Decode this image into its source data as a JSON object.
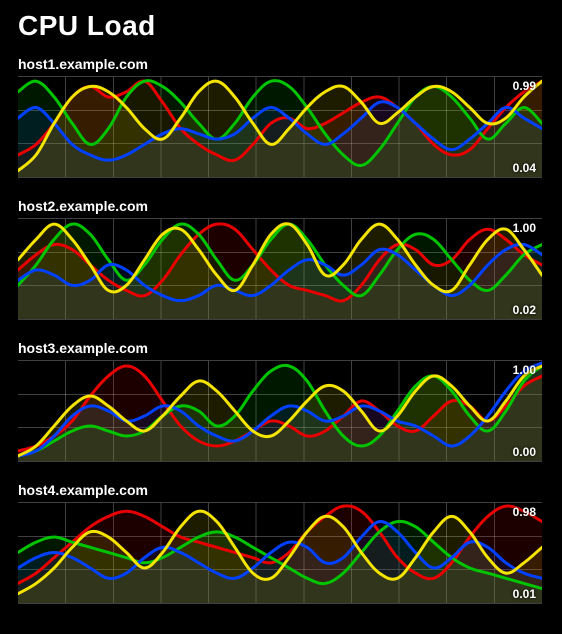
{
  "title": "CPU Load",
  "colors": {
    "red": "#e80000",
    "green": "#00c400",
    "blue": "#0040ff",
    "yellow": "#f5e400"
  },
  "grid": {
    "vlines": 11,
    "hlines": 3
  },
  "chart_data": [
    {
      "type": "line",
      "title": "host1.example.com",
      "ylim": [
        0.04,
        0.99
      ],
      "max_label": "0.99",
      "min_label": "0.04",
      "x": [
        0,
        1,
        2,
        3,
        4,
        5,
        6,
        7,
        8,
        9,
        10,
        11,
        12,
        13,
        14,
        15,
        16,
        17,
        18,
        19,
        20,
        21,
        22,
        23,
        24,
        25,
        26,
        27,
        28,
        29
      ],
      "series": [
        {
          "name": "red",
          "values": [
            0.25,
            0.35,
            0.55,
            0.8,
            0.9,
            0.8,
            0.85,
            0.95,
            0.75,
            0.5,
            0.35,
            0.25,
            0.2,
            0.35,
            0.55,
            0.6,
            0.5,
            0.55,
            0.65,
            0.75,
            0.8,
            0.7,
            0.55,
            0.35,
            0.25,
            0.3,
            0.5,
            0.7,
            0.85,
            0.95
          ]
        },
        {
          "name": "green",
          "values": [
            0.85,
            0.95,
            0.8,
            0.55,
            0.35,
            0.5,
            0.8,
            0.95,
            0.9,
            0.75,
            0.55,
            0.4,
            0.55,
            0.8,
            0.95,
            0.9,
            0.7,
            0.45,
            0.25,
            0.15,
            0.3,
            0.55,
            0.8,
            0.9,
            0.8,
            0.6,
            0.4,
            0.55,
            0.7,
            0.55
          ]
        },
        {
          "name": "blue",
          "values": [
            0.6,
            0.7,
            0.55,
            0.35,
            0.25,
            0.2,
            0.25,
            0.35,
            0.45,
            0.5,
            0.45,
            0.4,
            0.45,
            0.6,
            0.7,
            0.6,
            0.45,
            0.35,
            0.45,
            0.6,
            0.75,
            0.7,
            0.55,
            0.4,
            0.3,
            0.4,
            0.55,
            0.7,
            0.6,
            0.5
          ]
        },
        {
          "name": "yellow",
          "values": [
            0.1,
            0.25,
            0.55,
            0.8,
            0.9,
            0.85,
            0.7,
            0.5,
            0.4,
            0.6,
            0.85,
            0.95,
            0.8,
            0.55,
            0.35,
            0.5,
            0.7,
            0.85,
            0.9,
            0.75,
            0.55,
            0.65,
            0.8,
            0.9,
            0.85,
            0.7,
            0.55,
            0.6,
            0.8,
            0.95
          ]
        }
      ]
    },
    {
      "type": "line",
      "title": "host2.example.com",
      "ylim": [
        0.02,
        1.0
      ],
      "max_label": "1.00",
      "min_label": "0.02",
      "x": [
        0,
        1,
        2,
        3,
        4,
        5,
        6,
        7,
        8,
        9,
        10,
        11,
        12,
        13,
        14,
        15,
        16,
        17,
        18,
        19,
        20,
        21,
        22,
        23,
        24,
        25,
        26,
        27,
        28,
        29
      ],
      "series": [
        {
          "name": "red",
          "values": [
            0.5,
            0.65,
            0.75,
            0.7,
            0.55,
            0.4,
            0.3,
            0.25,
            0.4,
            0.65,
            0.85,
            0.95,
            0.9,
            0.7,
            0.5,
            0.35,
            0.3,
            0.25,
            0.2,
            0.35,
            0.6,
            0.75,
            0.7,
            0.55,
            0.6,
            0.8,
            0.9,
            0.8,
            0.65,
            0.55
          ]
        },
        {
          "name": "green",
          "values": [
            0.35,
            0.55,
            0.8,
            0.95,
            0.85,
            0.6,
            0.4,
            0.55,
            0.8,
            0.95,
            0.85,
            0.6,
            0.4,
            0.55,
            0.8,
            0.95,
            0.8,
            0.55,
            0.35,
            0.25,
            0.45,
            0.7,
            0.85,
            0.8,
            0.6,
            0.4,
            0.3,
            0.45,
            0.65,
            0.75
          ]
        },
        {
          "name": "blue",
          "values": [
            0.4,
            0.5,
            0.45,
            0.35,
            0.4,
            0.55,
            0.5,
            0.35,
            0.25,
            0.2,
            0.25,
            0.35,
            0.3,
            0.25,
            0.35,
            0.5,
            0.6,
            0.55,
            0.45,
            0.55,
            0.7,
            0.65,
            0.5,
            0.35,
            0.25,
            0.35,
            0.55,
            0.7,
            0.75,
            0.65
          ]
        },
        {
          "name": "yellow",
          "values": [
            0.6,
            0.8,
            0.95,
            0.8,
            0.55,
            0.3,
            0.35,
            0.6,
            0.85,
            0.9,
            0.7,
            0.45,
            0.3,
            0.55,
            0.85,
            0.95,
            0.75,
            0.45,
            0.55,
            0.8,
            0.95,
            0.8,
            0.55,
            0.35,
            0.3,
            0.55,
            0.8,
            0.9,
            0.7,
            0.45
          ]
        }
      ]
    },
    {
      "type": "line",
      "title": "host3.example.com",
      "ylim": [
        0.0,
        1.0
      ],
      "max_label": "1.00",
      "min_label": "0.00",
      "x": [
        0,
        1,
        2,
        3,
        4,
        5,
        6,
        7,
        8,
        9,
        10,
        11,
        12,
        13,
        14,
        15,
        16,
        17,
        18,
        19,
        20,
        21,
        22,
        23,
        24,
        25,
        26,
        27,
        28,
        29
      ],
      "series": [
        {
          "name": "red",
          "values": [
            0.1,
            0.15,
            0.25,
            0.4,
            0.65,
            0.85,
            0.95,
            0.85,
            0.6,
            0.35,
            0.2,
            0.15,
            0.2,
            0.3,
            0.4,
            0.35,
            0.25,
            0.3,
            0.45,
            0.6,
            0.5,
            0.35,
            0.3,
            0.45,
            0.6,
            0.55,
            0.4,
            0.55,
            0.75,
            0.85
          ]
        },
        {
          "name": "green",
          "values": [
            0.05,
            0.1,
            0.2,
            0.3,
            0.35,
            0.3,
            0.25,
            0.3,
            0.45,
            0.55,
            0.5,
            0.35,
            0.45,
            0.7,
            0.9,
            0.95,
            0.8,
            0.5,
            0.25,
            0.15,
            0.25,
            0.5,
            0.75,
            0.85,
            0.7,
            0.45,
            0.3,
            0.5,
            0.8,
            0.95
          ]
        },
        {
          "name": "blue",
          "values": [
            0.05,
            0.1,
            0.25,
            0.45,
            0.55,
            0.5,
            0.4,
            0.45,
            0.55,
            0.5,
            0.35,
            0.25,
            0.2,
            0.3,
            0.45,
            0.55,
            0.5,
            0.4,
            0.45,
            0.55,
            0.5,
            0.4,
            0.35,
            0.25,
            0.15,
            0.25,
            0.45,
            0.7,
            0.9,
            0.98
          ]
        },
        {
          "name": "yellow",
          "values": [
            0.05,
            0.15,
            0.35,
            0.55,
            0.65,
            0.55,
            0.4,
            0.3,
            0.45,
            0.65,
            0.8,
            0.7,
            0.5,
            0.3,
            0.25,
            0.4,
            0.6,
            0.75,
            0.7,
            0.5,
            0.3,
            0.45,
            0.7,
            0.85,
            0.75,
            0.55,
            0.4,
            0.6,
            0.85,
            0.95
          ]
        }
      ]
    },
    {
      "type": "line",
      "title": "host4.example.com",
      "ylim": [
        0.01,
        0.98
      ],
      "max_label": "0.98",
      "min_label": "0.01",
      "x": [
        0,
        1,
        2,
        3,
        4,
        5,
        6,
        7,
        8,
        9,
        10,
        11,
        12,
        13,
        14,
        15,
        16,
        17,
        18,
        19,
        20,
        21,
        22,
        23,
        24,
        25,
        26,
        27,
        28,
        29
      ],
      "series": [
        {
          "name": "red",
          "values": [
            0.2,
            0.3,
            0.45,
            0.6,
            0.75,
            0.85,
            0.9,
            0.85,
            0.75,
            0.65,
            0.6,
            0.55,
            0.5,
            0.45,
            0.4,
            0.5,
            0.7,
            0.85,
            0.95,
            0.9,
            0.7,
            0.45,
            0.3,
            0.25,
            0.4,
            0.65,
            0.85,
            0.95,
            0.9,
            0.8
          ]
        },
        {
          "name": "green",
          "values": [
            0.5,
            0.6,
            0.65,
            0.6,
            0.55,
            0.5,
            0.45,
            0.4,
            0.45,
            0.55,
            0.65,
            0.7,
            0.65,
            0.55,
            0.45,
            0.35,
            0.25,
            0.2,
            0.3,
            0.5,
            0.7,
            0.8,
            0.75,
            0.6,
            0.45,
            0.35,
            0.3,
            0.25,
            0.2,
            0.15
          ]
        },
        {
          "name": "blue",
          "values": [
            0.35,
            0.45,
            0.5,
            0.45,
            0.35,
            0.25,
            0.3,
            0.45,
            0.55,
            0.5,
            0.4,
            0.3,
            0.25,
            0.35,
            0.5,
            0.6,
            0.55,
            0.4,
            0.45,
            0.65,
            0.8,
            0.7,
            0.5,
            0.35,
            0.45,
            0.6,
            0.55,
            0.4,
            0.3,
            0.25
          ]
        },
        {
          "name": "yellow",
          "values": [
            0.1,
            0.2,
            0.35,
            0.55,
            0.7,
            0.65,
            0.5,
            0.35,
            0.5,
            0.75,
            0.9,
            0.8,
            0.55,
            0.3,
            0.25,
            0.45,
            0.7,
            0.85,
            0.75,
            0.5,
            0.3,
            0.25,
            0.45,
            0.7,
            0.85,
            0.7,
            0.45,
            0.3,
            0.4,
            0.55
          ]
        }
      ]
    }
  ]
}
